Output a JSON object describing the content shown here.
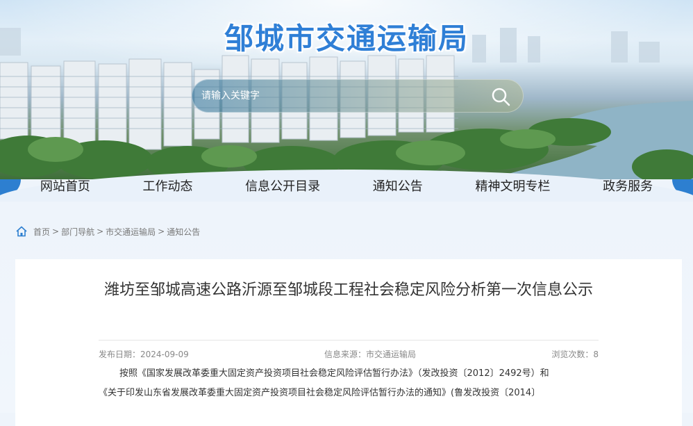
{
  "header": {
    "site_title": "邹城市交通运输局",
    "search": {
      "placeholder": "请输入关键字",
      "value": ""
    }
  },
  "nav": {
    "items": [
      "网站首页",
      "工作动态",
      "信息公开目录",
      "通知公告",
      "精神文明专栏",
      "政务服务"
    ]
  },
  "breadcrumb": {
    "items": [
      "首页",
      "部门导航",
      "市交通运输局",
      "通知公告"
    ],
    "separator": ">"
  },
  "article": {
    "title": "潍坊至邹城高速公路沂源至邹城段工程社会稳定风险分析第一次信息公示",
    "publish_date_label": "发布日期：",
    "publish_date": "2024-09-09",
    "source_label": "信息来源：",
    "source": "市交通运输局",
    "views_label": "浏览次数：",
    "views": "8",
    "paragraph_line1": "按照《国家发展改革委重大固定资产投资项目社会稳定风险评估暂行办法》（发改投资〔2012〕2492号）和",
    "paragraph_line2": "《关于印发山东省发展改革委重大固定资产投资项目社会稳定风险评估暂行办法的通知》(鲁发改投资〔2014〕"
  },
  "colors": {
    "accent_blue": "#2d7fd0",
    "title_blue": "#2f7fd6"
  }
}
